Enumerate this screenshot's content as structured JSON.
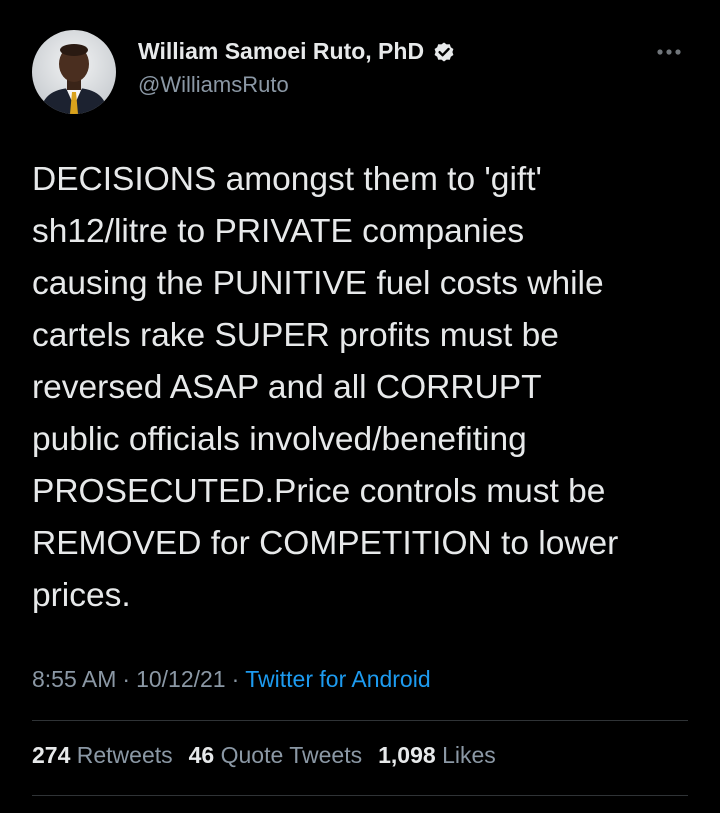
{
  "user": {
    "display_name": "William Samoei Ruto, PhD",
    "handle": "@WilliamsRuto",
    "avatar_icon": "profile-photo",
    "verified_icon": "verified-badge-icon"
  },
  "tweet": {
    "text": "DECISIONS amongst them to 'gift'\nsh12/litre to PRIVATE companies\ncausing the PUNITIVE fuel costs while\ncartels rake SUPER profits must be\nreversed ASAP and all CORRUPT\npublic officials involved/benefiting\nPROSECUTED.Price controls must be\nREMOVED for COMPETITION to lower\nprices.",
    "time": "8:55 AM",
    "separator": "·",
    "date": "10/12/21",
    "source": "Twitter for Android"
  },
  "stats": {
    "retweets_count": "274",
    "retweets_label": "Retweets",
    "quotes_count": "46",
    "quotes_label": "Quote Tweets",
    "likes_count": "1,098",
    "likes_label": "Likes"
  },
  "colors": {
    "background": "#000000",
    "primary_text": "#e7e9ea",
    "secondary_text": "#8b98a5",
    "link": "#1d9bf0",
    "divider": "#2f3336"
  }
}
